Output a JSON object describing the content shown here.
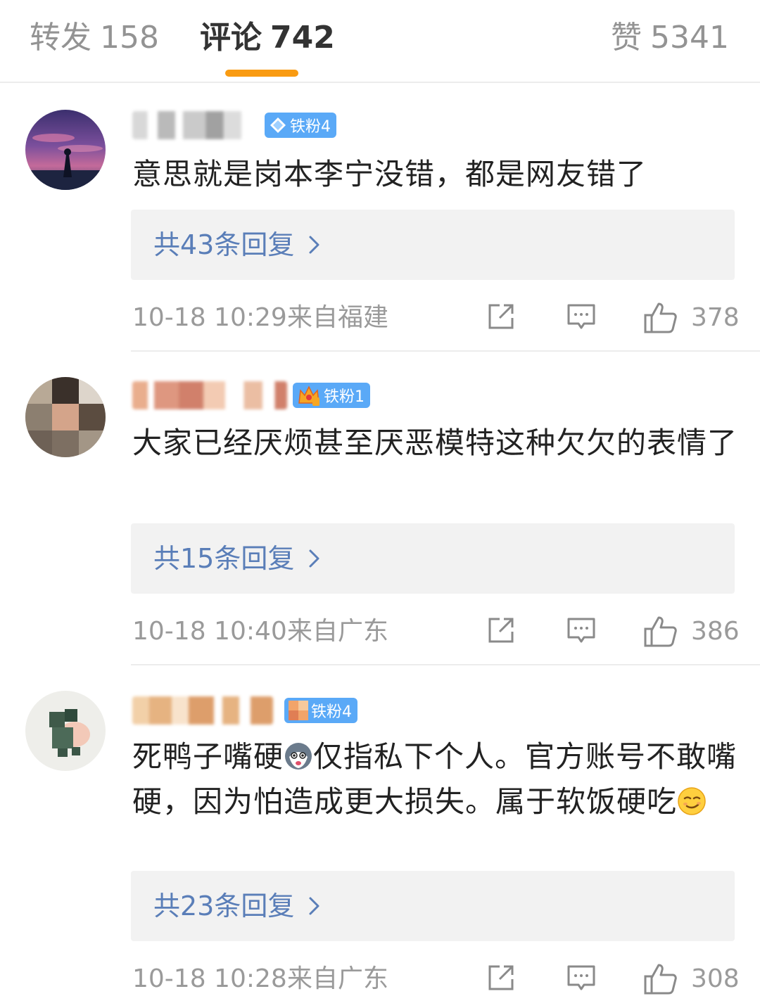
{
  "colors": {
    "accent_orange": "#f99b12",
    "link_blue": "#5a7eb8",
    "badge_blue": "#5aa9f7",
    "muted_gray": "#9a9a9a"
  },
  "tabs": {
    "reposts": {
      "label": "转发",
      "count": "158"
    },
    "comments": {
      "label": "评论",
      "count": "742",
      "active": true
    },
    "likes": {
      "label": "赞",
      "count": "5341"
    }
  },
  "comments": [
    {
      "username": "",
      "badge": {
        "icon": "diamond-icon",
        "label": "铁粉4"
      },
      "text": "意思就是岗本李宁没错，都是网友错了",
      "replies": "共43条回复",
      "time": "10-18 10:29",
      "location": "来自福建",
      "likes": "378"
    },
    {
      "username": "",
      "badge": {
        "icon": "crown-icon",
        "label": "铁粉1"
      },
      "text": "大家已经厌烦甚至厌恶模特这种欠欠的表情了",
      "replies": "共15条回复",
      "time": "10-18 10:40",
      "location": "来自广东",
      "likes": "386"
    },
    {
      "username": "",
      "badge": {
        "icon": "blurred-icon",
        "label": "铁粉4"
      },
      "text_part1": "死鸭子嘴硬",
      "text_part2": "仅指私下个人。官方账号不敢嘴硬，因为怕造成更大损失。属于软饭硬吃",
      "emojis": [
        "husky-emoji",
        "smirk-emoji"
      ],
      "replies": "共23条回复",
      "time": "10-18 10:28",
      "location": "来自广东",
      "likes": "308"
    }
  ]
}
